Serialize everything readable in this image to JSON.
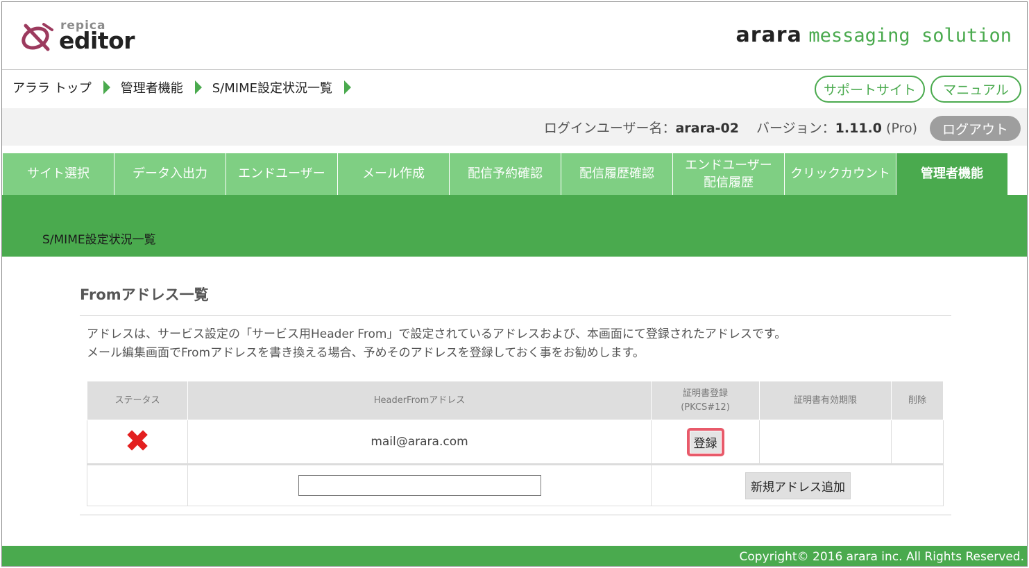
{
  "header": {
    "logo_small": "repica",
    "logo_large": "editor",
    "brand_bold": "arara",
    "brand_light": "messaging solution"
  },
  "breadcrumb": [
    {
      "label": "アララ トップ"
    },
    {
      "label": "管理者機能"
    },
    {
      "label": "S/MIME設定状況一覧"
    }
  ],
  "links": {
    "support": "サポートサイト",
    "manual": "マニュアル"
  },
  "user": {
    "login_label": "ログインユーザー名：",
    "login_name": "arara-02",
    "version_label": "バージョン：",
    "version": "1.11.0",
    "edition": "(Pro)",
    "logout": "ログアウト"
  },
  "tabs": [
    {
      "label": "サイト選択"
    },
    {
      "label": "データ入出力"
    },
    {
      "label": "エンドユーザー"
    },
    {
      "label": "メール作成"
    },
    {
      "label": "配信予約確認"
    },
    {
      "label": "配信履歴確認"
    },
    {
      "label": "エンドユーザー\n配信履歴"
    },
    {
      "label": "クリックカウント"
    },
    {
      "label": "管理者機能"
    }
  ],
  "active_tab": "管理者機能",
  "page_title": "S/MIME設定状況一覧",
  "section": {
    "title": "Fromアドレス一覧",
    "desc_line1": "アドレスは、サービス設定の「サービス用Header From」で設定されているアドレスおよび、本画面にて登録されたアドレスです。",
    "desc_line2": "メール編集画面でFromアドレスを書き換える場合、予めそのアドレスを登録しておく事をお勧めします。"
  },
  "table": {
    "headers": {
      "status": "ステータス",
      "address": "HeaderFromアドレス",
      "cert_reg": "証明書登録",
      "cert_reg_sub": "(PKCS#12)",
      "cert_expiry": "証明書有効期限",
      "delete": "削除"
    },
    "rows": [
      {
        "status_icon": "x-mark-icon",
        "status_glyph": "✖",
        "address": "mail@arara.com",
        "register_label": "登録",
        "expiry": "",
        "delete": ""
      }
    ],
    "new_address": {
      "value": "",
      "button": "新規アドレス追加"
    }
  },
  "footer": {
    "copyright": "Copyright© 2016 arara inc. All Rights Reserved."
  },
  "colors": {
    "accent": "#4aaa4e",
    "tab": "#7fcf83",
    "error": "#e32020",
    "highlight": "#e85a6a"
  }
}
